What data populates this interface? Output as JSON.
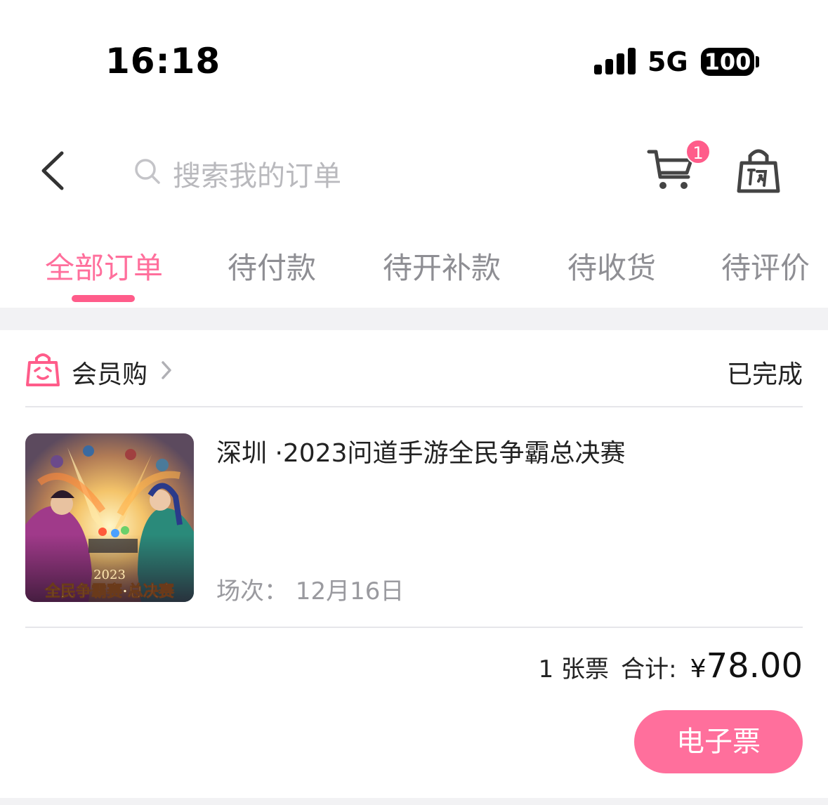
{
  "status_bar": {
    "time": "16:18",
    "network": "5G",
    "battery": "100"
  },
  "nav": {
    "search_placeholder": "搜索我的订单",
    "cart_badge": "1"
  },
  "tabs": [
    {
      "label": "全部订单",
      "active": true
    },
    {
      "label": "待付款",
      "active": false
    },
    {
      "label": "待开补款",
      "active": false
    },
    {
      "label": "待收货",
      "active": false
    },
    {
      "label": "待评价",
      "active": false
    }
  ],
  "order": {
    "shop_name": "会员购",
    "status": "已完成",
    "product_title": "深圳 ·2023问道手游全民争霸总决赛",
    "thumb_caption_year": "2023",
    "thumb_caption_text": "全民争霸赛·总决赛",
    "session": "场次：  12月16日",
    "ticket_count": "1 张票",
    "total_label": "合计:",
    "currency": "¥",
    "amount": "78.00",
    "action_label": "电子票"
  },
  "colors": {
    "accent": "#ff6f9c",
    "badge": "#ff5c8a",
    "muted_text": "#8e8e93",
    "divider": "#f2f2f4"
  }
}
